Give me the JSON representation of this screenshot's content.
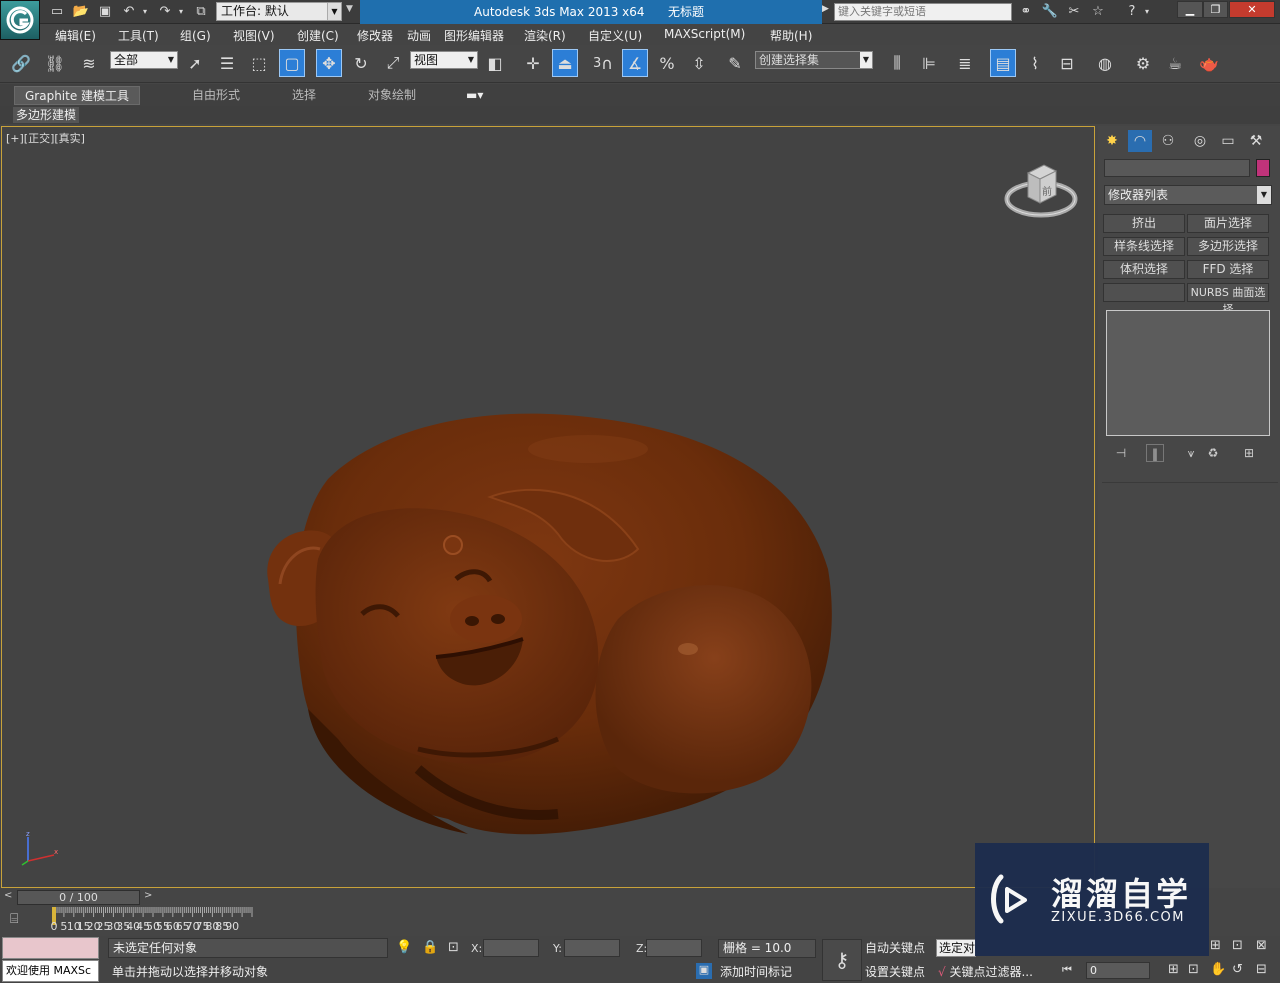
{
  "window": {
    "app_name": "Autodesk 3ds Max  2013 x64",
    "doc_title": "无标题",
    "workspace": "工作台: 默认",
    "search_placeholder": "键入关键字或短语"
  },
  "menu": [
    "编辑(E)",
    "工具(T)",
    "组(G)",
    "视图(V)",
    "创建(C)",
    "修改器",
    "动画",
    "图形编辑器",
    "渲染(R)",
    "自定义(U)",
    "MAXScript(M)",
    "帮助(H)"
  ],
  "toolbar": {
    "filter": "全部",
    "refcoord": "视图",
    "snap_num": "3",
    "named_selset": "创建选择集",
    "move_active": true
  },
  "ribbon": {
    "tabs": [
      "Graphite 建模工具",
      "自由形式",
      "选择",
      "对象绘制"
    ],
    "active": "Graphite 建模工具",
    "panel": "多边形建模"
  },
  "viewport": {
    "label": "[+][正交][真实]",
    "viewcube_face": "前",
    "model_color": "#6e2e0c"
  },
  "command_panel": {
    "modifier_list": "修改器列表",
    "object_color": "#c0337a",
    "buttons": [
      "挤出",
      "面片选择",
      "样条线选择",
      "多边形选择",
      "体积选择",
      "FFD 选择",
      "",
      "NURBS 曲面选择"
    ]
  },
  "timeline": {
    "slider": "0 / 100",
    "ticks": [
      "0",
      "5",
      "10",
      "15",
      "20",
      "25",
      "30",
      "35",
      "40",
      "45",
      "50",
      "55",
      "60",
      "65",
      "70",
      "75",
      "80",
      "85",
      "90"
    ]
  },
  "status": {
    "welcome": "欢迎使用 MAXSc",
    "line1": "未选定任何对象",
    "line2": "单击并拖动以选择并移动对象",
    "x_label": "X:",
    "y_label": "Y:",
    "z_label": "Z:",
    "grid": "栅格 = 10.0",
    "add_time_tag": "添加时间标记",
    "auto_key": "自动关键点",
    "set_key": "设置关键点",
    "selected": "选定对",
    "key_filter": "关键点过滤器...",
    "frame": "0"
  },
  "watermark": {
    "name": "溜溜自学",
    "url": "ZIXUE.3D66.COM"
  }
}
